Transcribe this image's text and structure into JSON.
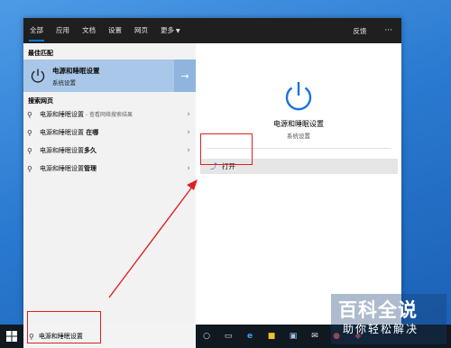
{
  "tabs": [
    {
      "label": "全部"
    },
    {
      "label": "应用"
    },
    {
      "label": "文档"
    },
    {
      "label": "设置"
    },
    {
      "label": "网页"
    },
    {
      "label": "更多"
    }
  ],
  "topbar": {
    "feedback": "反馈",
    "more": "···"
  },
  "best_match": {
    "header": "最佳匹配",
    "title": "电源和睡眠设置",
    "subtitle": "系统设置",
    "arrow": "→"
  },
  "web_search": {
    "header": "搜索网页",
    "items": [
      {
        "prefix": "电源和睡眠设置",
        "suffix": " - 查看网络搜索结果"
      },
      {
        "prefix": "电源和睡眠设置 ",
        "suffix": "在哪"
      },
      {
        "prefix": "电源和睡眠设置",
        "suffix": "多久"
      },
      {
        "prefix": "电源和睡眠设置",
        "suffix": "管理"
      }
    ]
  },
  "detail": {
    "title": "电源和睡眠设置",
    "subtitle": "系统设置",
    "action_open": "打开"
  },
  "taskbar": {
    "search_value": "电源和睡眠设置",
    "icons": [
      "cortana-icon",
      "task-view-icon",
      "edge-icon",
      "file-explorer-icon",
      "store-icon",
      "mail-icon",
      "chrome-icon",
      "app-icon"
    ]
  },
  "watermark": {
    "line1": "百科全说",
    "line2": "助你轻松解决"
  },
  "colors": {
    "accent": "#0078d7",
    "annotation": "#e02020",
    "selection": "#a9c7e9"
  }
}
